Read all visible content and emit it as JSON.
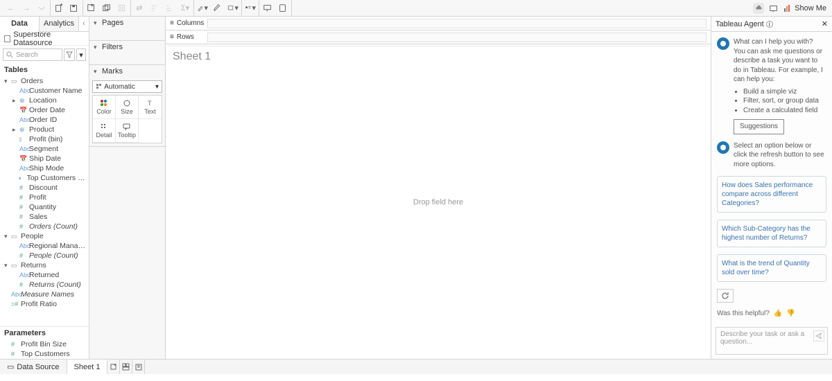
{
  "toolbar": {
    "showme": "Show Me"
  },
  "tabs": {
    "data": "Data",
    "analytics": "Analytics"
  },
  "datasource": "Superstore Datasource",
  "search": {
    "placeholder": "Search"
  },
  "sections": {
    "tables": "Tables",
    "parameters": "Parameters"
  },
  "tree": {
    "orders": "Orders",
    "orders_fields": [
      {
        "t": "Abc",
        "l": "Customer Name"
      },
      {
        "t": "geo",
        "l": "Location",
        "caret": true
      },
      {
        "t": "date",
        "l": "Order Date"
      },
      {
        "t": "Abc",
        "l": "Order ID"
      },
      {
        "t": "geo",
        "l": "Product",
        "caret": true
      },
      {
        "t": "bin",
        "l": "Profit (bin)"
      },
      {
        "t": "Abc",
        "l": "Segment"
      },
      {
        "t": "date",
        "l": "Ship Date"
      },
      {
        "t": "Abc",
        "l": "Ship Mode"
      },
      {
        "t": "set",
        "l": "Top Customers by P..."
      },
      {
        "t": "num",
        "l": "Discount"
      },
      {
        "t": "num",
        "l": "Profit"
      },
      {
        "t": "num",
        "l": "Quantity"
      },
      {
        "t": "num",
        "l": "Sales"
      },
      {
        "t": "num",
        "l": "Orders (Count)",
        "italic": true
      }
    ],
    "people": "People",
    "people_fields": [
      {
        "t": "Abc",
        "l": "Regional Manager"
      },
      {
        "t": "num",
        "l": "People (Count)",
        "italic": true
      }
    ],
    "returns": "Returns",
    "returns_fields": [
      {
        "t": "Abc",
        "l": "Returned"
      },
      {
        "t": "num",
        "l": "Returns (Count)",
        "italic": true
      }
    ],
    "extra": [
      {
        "t": "Abc",
        "l": "Measure Names",
        "italic": true
      },
      {
        "t": "calc",
        "l": "Profit Ratio"
      }
    ],
    "params": [
      {
        "t": "num",
        "l": "Profit Bin Size"
      },
      {
        "t": "num",
        "l": "Top Customers"
      }
    ]
  },
  "shelves": {
    "pages": "Pages",
    "filters": "Filters",
    "marks": "Marks",
    "columns": "Columns",
    "rows": "Rows"
  },
  "marks": {
    "mode": "Automatic",
    "cells": [
      "Color",
      "Size",
      "Text",
      "Detail",
      "Tooltip"
    ]
  },
  "canvas": {
    "title": "Sheet 1",
    "hint": "Drop field here"
  },
  "agent": {
    "title": "Tableau Agent",
    "intro": "What can I help you with?",
    "intro2": "You can ask me questions or describe a task you want to do in Tableau. For example, I can help you:",
    "bullets": [
      "Build a simple viz",
      "Filter, sort, or group data",
      "Create a calculated field"
    ],
    "suggestions_btn": "Suggestions",
    "prompt2": "Select an option below or click the refresh button to see more options.",
    "cards": [
      "How does Sales performance compare across different Categories?",
      "Which Sub-Category has the highest number of Returns?",
      "What is the trend of Quantity sold over time?"
    ],
    "helpful": "Was this helpful?",
    "input_placeholder": "Describe your task or ask a question..."
  },
  "bottom": {
    "datasource": "Data Source",
    "sheet": "Sheet 1"
  }
}
